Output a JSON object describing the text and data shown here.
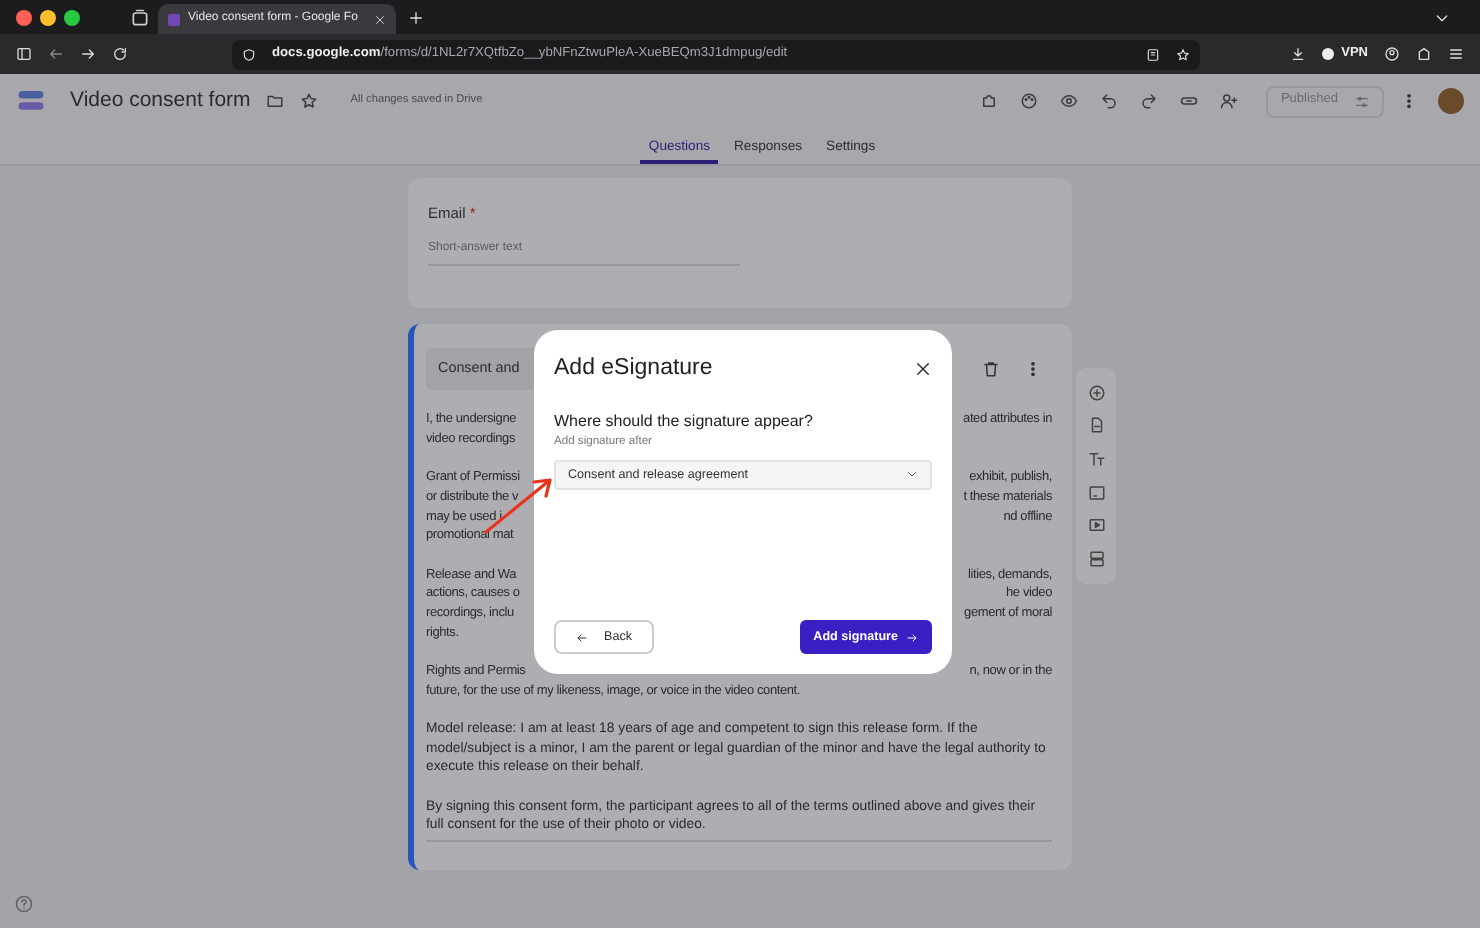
{
  "browser": {
    "tab_title": "Video consent form - Google Fo",
    "url": "**docs.google.com**/forms/d/1NL2r7XQtfbZo__ybNFnZtwuPleA-XueBEQm3J1dmpug/edit",
    "vpn_label": "VPN"
  },
  "app_header": {
    "title": "Video consent form",
    "save_status": "All changes saved in Drive",
    "publish_button": "Published"
  },
  "tabs": [
    {
      "label": "Questions",
      "selected": true
    },
    {
      "label": "Responses",
      "selected": false
    },
    {
      "label": "Settings",
      "selected": false
    }
  ],
  "questions": [
    {
      "kind": "short_answer",
      "title": "Email",
      "required_mark": "*",
      "placeholder": "Short-answer text",
      "focused": false
    },
    {
      "kind": "text_block",
      "title": "Consent and",
      "focused": true,
      "paragraphs": [
        {
          "lines": [
            {
              "left": "I, the undersigne",
              "right": "ated attributes in"
            },
            {
              "left": "video recordings"
            }
          ]
        },
        {
          "lines": [
            {
              "left": "Grant of Permissi",
              "right": "exhibit, publish,"
            },
            {
              "left": "or distribute the v",
              "right": "t these materials"
            },
            {
              "left": "may be used i",
              "right": "nd offline"
            },
            {
              "left": "promotional mat"
            }
          ]
        },
        {
          "lines": [
            {
              "left": "Release and Wa",
              "right": "lities, demands,"
            },
            {
              "left": "actions, causes o",
              "right": "he video"
            },
            {
              "left": "recordings, inclu",
              "right": "gement of moral"
            },
            {
              "left": "rights."
            }
          ]
        },
        {
          "lines": [
            {
              "left": "Rights and Permis",
              "right": "n, now or in the"
            },
            {
              "left": "future, for the use of my likeness, image, or voice in the video content."
            }
          ]
        },
        {
          "text": "Model release: I am at least 18 years of age and competent to sign this release form. If the model/subject is a minor, I am the parent or legal guardian of the minor and have the legal authority to execute this release on their behalf."
        },
        {
          "text": "By signing this consent form, the participant agrees to all of the terms outlined above and gives their full consent for the use of their photo or video."
        }
      ]
    }
  ],
  "dialog": {
    "title": "Add eSignature",
    "question": "Where should the signature appear?",
    "field_label": "Add signature after",
    "select_value": "Consent and release agreement",
    "back_button": "Back",
    "confirm_button": "Add signature"
  }
}
